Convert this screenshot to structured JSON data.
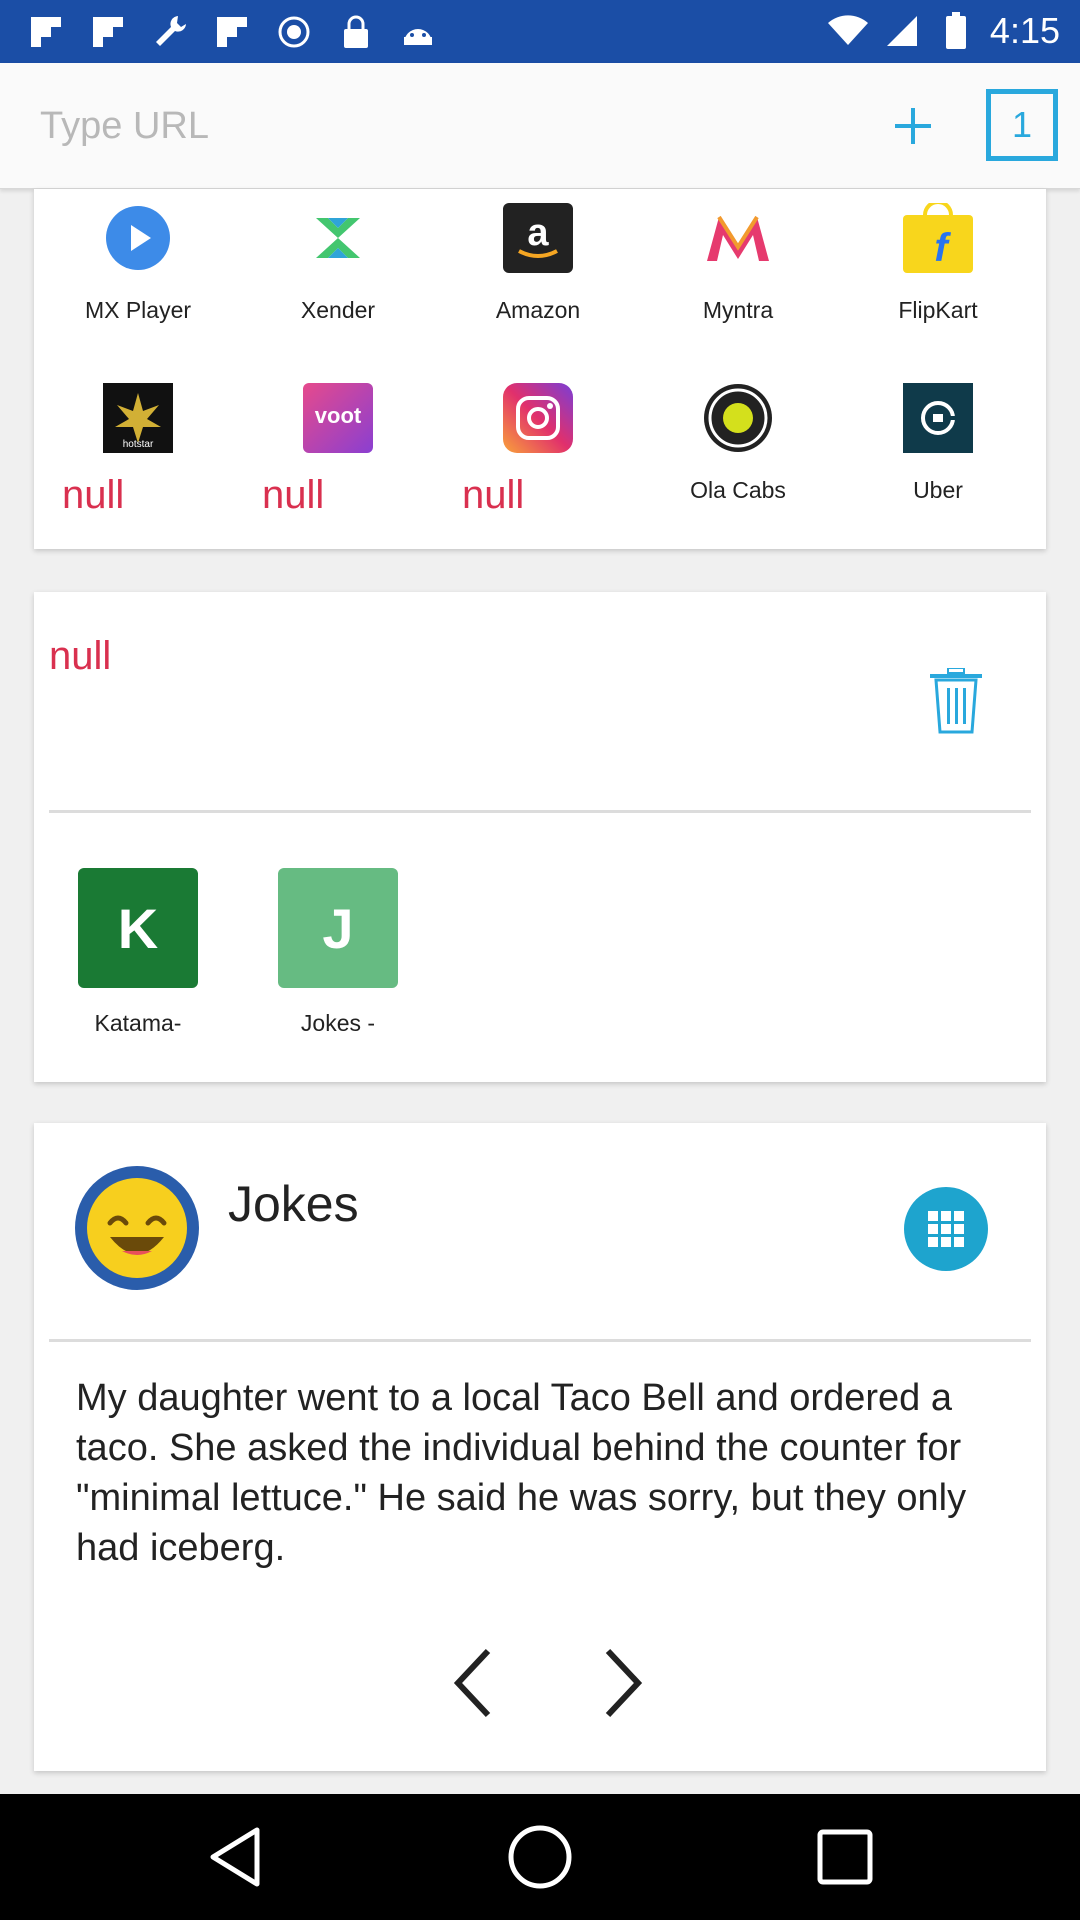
{
  "status_bar": {
    "time": "4:15",
    "left_icons": [
      "flipboard-icon",
      "flipboard-icon",
      "wrench-icon",
      "flipboard-icon",
      "sync-icon",
      "lock-icon",
      "android-icon"
    ],
    "right_icons": [
      "wifi-icon",
      "signal-icon",
      "battery-icon"
    ]
  },
  "url_bar": {
    "placeholder": "Type URL",
    "tab_count": "1"
  },
  "quick_links": {
    "row1": [
      {
        "label": "MX Player",
        "icon": "play-icon"
      },
      {
        "label": "Xender",
        "icon": "xender-icon"
      },
      {
        "label": "Amazon",
        "icon": "amazon-icon"
      },
      {
        "label": "Myntra",
        "icon": "myntra-icon"
      },
      {
        "label": "FlipKart",
        "icon": "flipkart-icon"
      }
    ],
    "row2": [
      {
        "label": "null",
        "icon": "hotstar-icon",
        "icon_text": "hotstar"
      },
      {
        "label": "null",
        "icon": "voot-icon",
        "icon_text": "voot"
      },
      {
        "label": "null",
        "icon": "instagram-icon"
      },
      {
        "label": "Ola Cabs",
        "icon": "ola-icon"
      },
      {
        "label": "Uber",
        "icon": "uber-icon"
      }
    ]
  },
  "recent": {
    "title": "null",
    "tiles": [
      {
        "letter": "K",
        "label": "Katama-",
        "color": "#1a7a34"
      },
      {
        "letter": "J",
        "label": "Jokes -",
        "color": "#66bb82"
      }
    ]
  },
  "jokes_card": {
    "title": "Jokes",
    "text": "My daughter went to a local Taco Bell and ordered a taco. She asked the individual behind the counter for \"minimal lettuce.\" He said he was sorry, but they only had iceberg."
  },
  "colors": {
    "status_bar": "#1b4ea6",
    "accent": "#29a8dd",
    "null_text": "#d9304f"
  }
}
